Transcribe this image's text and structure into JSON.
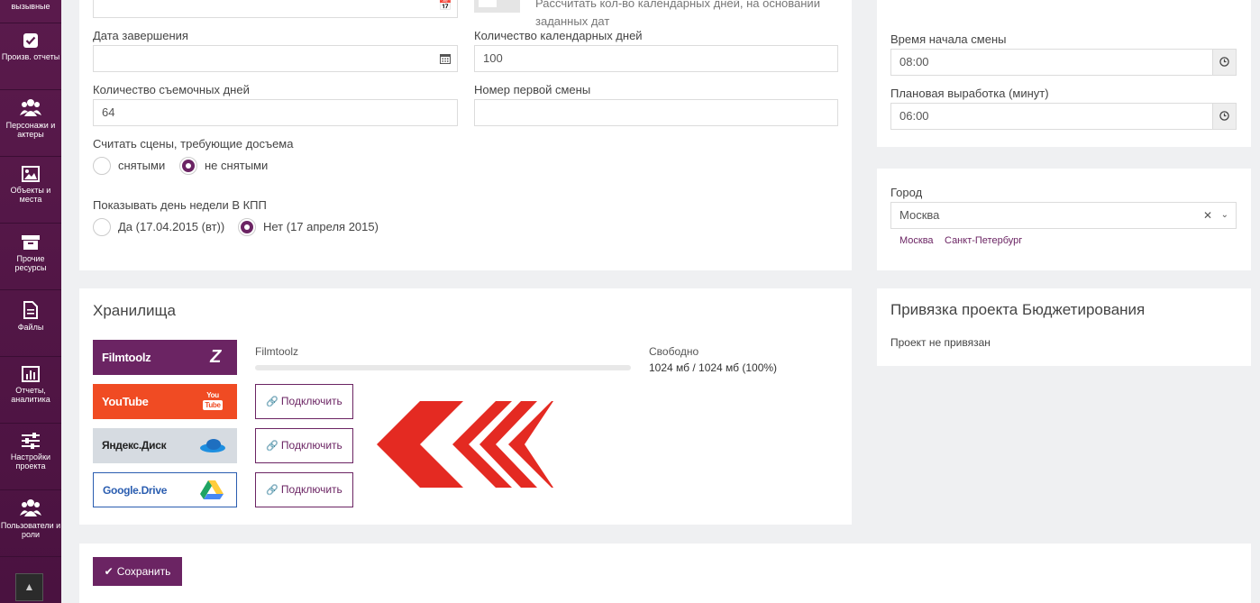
{
  "sidebar": {
    "items": [
      {
        "label": "вызывные",
        "icon": "bell-icon"
      },
      {
        "label": "Произв. отчеты",
        "icon": "checkbox-icon"
      },
      {
        "label": "Персонажи и актеры",
        "icon": "users-icon"
      },
      {
        "label": "Объекты и места",
        "icon": "image-icon"
      },
      {
        "label": "Прочие ресурсы",
        "icon": "archive-icon"
      },
      {
        "label": "Файлы",
        "icon": "file-icon"
      },
      {
        "label": "Отчеты, аналитика",
        "icon": "bar-chart-icon"
      },
      {
        "label": "Настройки проекта",
        "icon": "sliders-icon"
      },
      {
        "label": "Пользователи и роли",
        "icon": "users-icon"
      }
    ],
    "scroll_top_icon": "arrow-up-icon"
  },
  "main": {
    "toggle_text": "Рассчитать кол-во календарных дней, на основании заданных дат",
    "end_date_label": "Дата завершения",
    "end_date_value": "",
    "calendar_days_label": "Количество календарных дней",
    "calendar_days_value": "100",
    "shooting_days_label": "Количество съемочных дней",
    "shooting_days_value": "64",
    "first_shift_label": "Номер первой смены",
    "first_shift_value": "",
    "reshoot_label": "Считать сцены, требующие досъема",
    "reshoot_options": [
      "снятыми",
      "не снятыми"
    ],
    "reshoot_selected": 1,
    "weekday_label": "Показывать день недели В КПП",
    "weekday_options": [
      "Да (17.04.2015 (вт))",
      "Нет (17 апреля 2015)"
    ],
    "weekday_selected": 1
  },
  "right": {
    "shift_start_label": "Время начала смены",
    "shift_start_value": "08:00",
    "planned_output_label": "Плановая выработка (минут)",
    "planned_output_value": "06:00",
    "city_label": "Город",
    "city_value": "Москва",
    "city_suggestions": [
      "Москва",
      "Санкт-Петербург"
    ],
    "budget_title": "Привязка проекта Бюджетирования",
    "budget_status": "Проект не привязан"
  },
  "storage": {
    "title": "Хранилища",
    "providers": [
      {
        "name": "Filmtoolz",
        "bg": "#6b2463",
        "color": "#ffffff"
      },
      {
        "name": "YouTube",
        "bg": "#f04b23",
        "color": "#ffffff"
      },
      {
        "name": "Яндекс.Диск",
        "bg": "#d6dbe1",
        "color": "#222222"
      },
      {
        "name": "Google.Drive",
        "bg": "#ffffff",
        "color": "#2a5db0"
      }
    ],
    "filmtoolz_label": "Filmtoolz",
    "free_label": "Свободно",
    "free_value": "1024 мб / 1024 мб (100%)",
    "free_fraction": 1.0,
    "connect_label": "Подключить"
  },
  "footer": {
    "save_label": "Сохранить"
  },
  "colors": {
    "accent": "#6b2463",
    "arrow": "#e42a22"
  }
}
